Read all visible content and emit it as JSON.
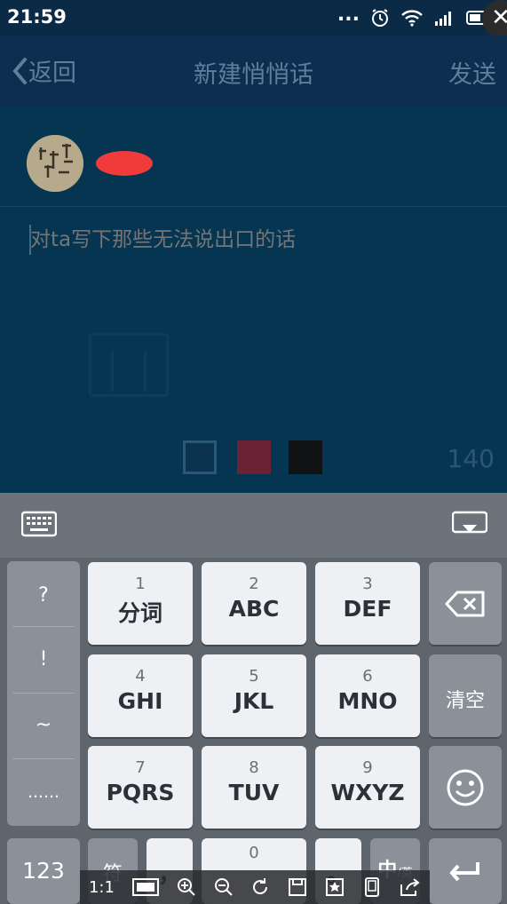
{
  "status_bar": {
    "time": "21:59",
    "more": "..."
  },
  "nav": {
    "back_label": "返回",
    "title": "新建悄悄话",
    "send_label": "发送"
  },
  "composer": {
    "placeholder": "对ta写下那些无法说出口的话",
    "value": "",
    "char_remaining": "140"
  },
  "colors": {
    "swatch_colors": [
      "#0b3350",
      "#6a2234",
      "#101214"
    ]
  },
  "keyboard": {
    "symbols": [
      "?",
      "!",
      "~",
      "……"
    ],
    "rows": [
      [
        {
          "num": "1",
          "label": "分词"
        },
        {
          "num": "2",
          "label": "ABC"
        },
        {
          "num": "3",
          "label": "DEF"
        }
      ],
      [
        {
          "num": "4",
          "label": "GHI"
        },
        {
          "num": "5",
          "label": "JKL"
        },
        {
          "num": "6",
          "label": "MNO"
        }
      ],
      [
        {
          "num": "7",
          "label": "PQRS"
        },
        {
          "num": "8",
          "label": "TUV"
        },
        {
          "num": "9",
          "label": "WXYZ"
        }
      ]
    ],
    "clear_label": "清空",
    "numeric_label": "123",
    "symbol_label": "符",
    "comma_label": "，",
    "space_num": "0",
    "period_label": "。",
    "lang_main": "中",
    "lang_sub": "/英"
  },
  "viewer_toolbar": {
    "ratio_label": "1:1"
  }
}
